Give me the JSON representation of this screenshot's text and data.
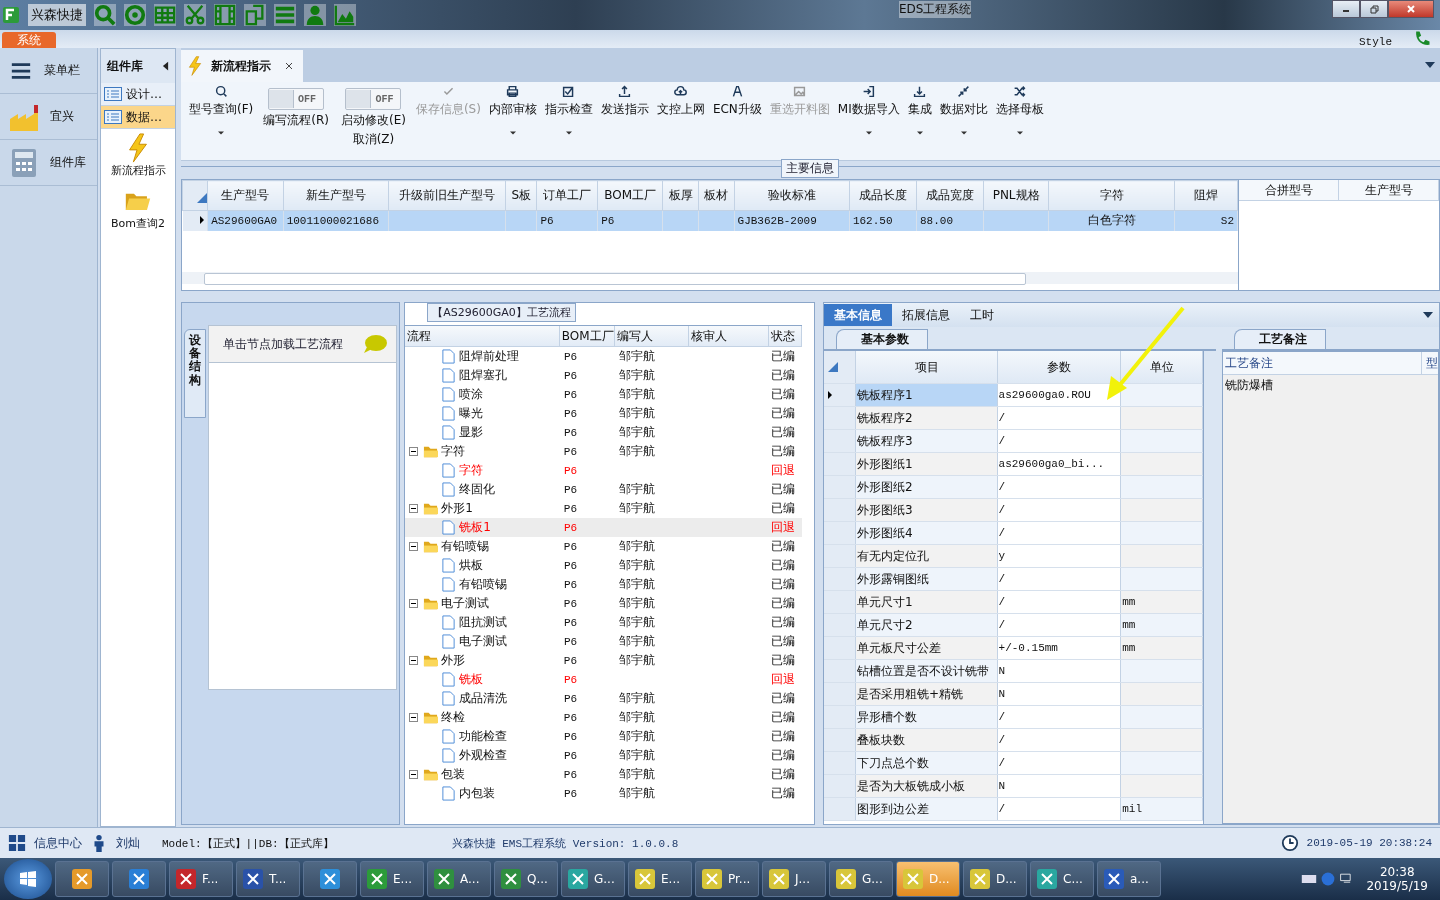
{
  "window": {
    "app_name": "兴森快捷",
    "title": "EDS工程系统"
  },
  "ribbon_tabs": [
    {
      "label": "系统",
      "selected": true
    }
  ],
  "style_menu": {
    "label": "Style"
  },
  "sidebar": {
    "items": [
      {
        "label": "菜单栏",
        "kind": "menu"
      },
      {
        "label": "宜兴",
        "kind": "factory"
      },
      {
        "label": "组件库",
        "kind": "calculator"
      }
    ]
  },
  "component_library": {
    "title": "组件库",
    "items": [
      {
        "label": "设计…",
        "kind": "list",
        "selected": false
      },
      {
        "label": "数据…",
        "kind": "list",
        "selected": true
      },
      {
        "label": "新流程指示",
        "kind": "bolt",
        "selected": false
      },
      {
        "label": "Bom查询2",
        "kind": "folder",
        "selected": false
      }
    ]
  },
  "document_tabs": [
    {
      "label": "新流程指示",
      "selected": true,
      "closable": true
    }
  ],
  "toolbar": [
    {
      "kind": "button",
      "label": "型号查询(F)",
      "disabled": false,
      "dropdown": true
    },
    {
      "kind": "toggle",
      "label": "编写流程(R)",
      "state_text": "OFF",
      "on": false
    },
    {
      "kind": "toggle",
      "label": "启动修改(E)",
      "sublabel": "取消(Z)",
      "state_text": "OFF",
      "on": false
    },
    {
      "kind": "button",
      "label": "保存信息(S)",
      "disabled": true,
      "dropdown": false
    },
    {
      "kind": "button",
      "label": "内部审核",
      "disabled": false,
      "dropdown": true
    },
    {
      "kind": "button",
      "label": "指示检查",
      "disabled": false,
      "dropdown": true
    },
    {
      "kind": "button",
      "label": "发送指示",
      "disabled": false,
      "dropdown": false
    },
    {
      "kind": "button",
      "label": "文控上网",
      "disabled": false,
      "dropdown": false
    },
    {
      "kind": "button",
      "label": "ECN升级",
      "disabled": false,
      "dropdown": false
    },
    {
      "kind": "button",
      "label": "重选开料图",
      "disabled": true,
      "dropdown": false
    },
    {
      "kind": "button",
      "label": "MI数据导入",
      "disabled": false,
      "dropdown": true
    },
    {
      "kind": "button",
      "label": "集成",
      "disabled": false,
      "dropdown": true
    },
    {
      "kind": "button",
      "label": "数据对比",
      "disabled": false,
      "dropdown": true
    },
    {
      "kind": "button",
      "label": "选择母板",
      "disabled": false,
      "dropdown": true
    }
  ],
  "main_info": {
    "title": "主要信息",
    "columns": [
      "生产型号",
      "新生产型号",
      "升级前旧生产型号",
      "S板",
      "订单工厂",
      "BOM工厂",
      "板厚",
      "板材",
      "验收标准",
      "成品长度",
      "成品宽度",
      "PNL规格",
      "字符",
      "阻焊"
    ],
    "rows": [
      {
        "selected": true,
        "cells": [
          "AS29600GA0",
          "10011000021686",
          null,
          null,
          "P6",
          "P6",
          null,
          null,
          "GJB362B-2009",
          "162.50",
          "88.00",
          null,
          "白色字符",
          "S2"
        ]
      }
    ],
    "side_columns": [
      "合拼型号",
      "生产型号"
    ]
  },
  "process": {
    "title": "【AS29600GA0】工艺流程",
    "side_tab": "设备结构",
    "hint": "单击节点加载工艺流程",
    "columns": [
      "流程",
      "BOM工厂",
      "编写人",
      "核审人",
      "状态"
    ],
    "tree": [
      {
        "children": [
          {
            "label": "阻焊前处理",
            "bom": "P6",
            "writer": "邹宇航",
            "status": "已编",
            "returned": false,
            "selected": false
          },
          {
            "label": "阻焊塞孔",
            "bom": "P6",
            "writer": "邹宇航",
            "status": "已编",
            "returned": false,
            "selected": false
          },
          {
            "label": "喷涂",
            "bom": "P6",
            "writer": "邹宇航",
            "status": "已编",
            "returned": false,
            "selected": false
          },
          {
            "label": "曝光",
            "bom": "P6",
            "writer": "邹宇航",
            "status": "已编",
            "returned": false,
            "selected": false
          },
          {
            "label": "显影",
            "bom": "P6",
            "writer": "邹宇航",
            "status": "已编",
            "returned": false,
            "selected": false
          }
        ]
      },
      {
        "label": "字符",
        "bom": "P6",
        "writer": "邹宇航",
        "status": "已编",
        "returned": false,
        "selected": false,
        "expanded": true,
        "children": [
          {
            "label": "字符",
            "bom": "P6",
            "status": "回退",
            "returned": true,
            "selected": false
          },
          {
            "label": "终固化",
            "bom": "P6",
            "writer": "邹宇航",
            "status": "已编",
            "returned": false,
            "selected": false
          }
        ]
      },
      {
        "label": "外形1",
        "bom": "P6",
        "writer": "邹宇航",
        "status": "已编",
        "returned": false,
        "selected": false,
        "expanded": true,
        "children": [
          {
            "label": "铣板1",
            "bom": "P6",
            "status": "回退",
            "returned": true,
            "selected": true
          }
        ]
      },
      {
        "label": "有铅喷锡",
        "bom": "P6",
        "writer": "邹宇航",
        "status": "已编",
        "returned": false,
        "selected": false,
        "expanded": true,
        "children": [
          {
            "label": "烘板",
            "bom": "P6",
            "writer": "邹宇航",
            "status": "已编",
            "returned": false,
            "selected": false
          },
          {
            "label": "有铅喷锡",
            "bom": "P6",
            "writer": "邹宇航",
            "status": "已编",
            "returned": false,
            "selected": false
          }
        ]
      },
      {
        "label": "电子测试",
        "bom": "P6",
        "writer": "邹宇航",
        "status": "已编",
        "returned": false,
        "selected": false,
        "expanded": true,
        "children": [
          {
            "label": "阻抗测试",
            "bom": "P6",
            "writer": "邹宇航",
            "status": "已编",
            "returned": false,
            "selected": false
          },
          {
            "label": "电子测试",
            "bom": "P6",
            "writer": "邹宇航",
            "status": "已编",
            "returned": false,
            "selected": false
          }
        ]
      },
      {
        "label": "外形",
        "bom": "P6",
        "writer": "邹宇航",
        "status": "已编",
        "returned": false,
        "selected": false,
        "expanded": true,
        "children": [
          {
            "label": "铣板",
            "bom": "P6",
            "status": "回退",
            "returned": true,
            "selected": false
          },
          {
            "label": "成品清洗",
            "bom": "P6",
            "writer": "邹宇航",
            "status": "已编",
            "returned": false,
            "selected": false
          }
        ]
      },
      {
        "label": "终检",
        "bom": "P6",
        "writer": "邹宇航",
        "status": "已编",
        "returned": false,
        "selected": false,
        "expanded": true,
        "children": [
          {
            "label": "功能检查",
            "bom": "P6",
            "writer": "邹宇航",
            "status": "已编",
            "returned": false,
            "selected": false
          },
          {
            "label": "外观检查",
            "bom": "P6",
            "writer": "邹宇航",
            "status": "已编",
            "returned": false,
            "selected": false
          }
        ]
      },
      {
        "label": "包装",
        "bom": "P6",
        "writer": "邹宇航",
        "status": "已编",
        "returned": false,
        "selected": false,
        "expanded": true,
        "children": [
          {
            "label": "内包装",
            "bom": "P6",
            "writer": "邹宇航",
            "status": "已编",
            "returned": false,
            "selected": false
          }
        ]
      }
    ]
  },
  "detail": {
    "tabs": [
      {
        "label": "基本信息",
        "selected": true
      },
      {
        "label": "拓展信息",
        "selected": false
      },
      {
        "label": "工时",
        "selected": false
      }
    ],
    "sub_tab": "基本参数",
    "columns": [
      "项目",
      "参数",
      "单位"
    ],
    "rows": [
      {
        "item": "铣板程序1",
        "value": "as29600ga0.ROU",
        "selected": true
      },
      {
        "item": "铣板程序2",
        "value": "/",
        "selected": false
      },
      {
        "item": "铣板程序3",
        "value": "/",
        "selected": false
      },
      {
        "item": "外形图纸1",
        "value": "as29600ga0_bi...",
        "selected": false
      },
      {
        "item": "外形图纸2",
        "value": "/",
        "selected": false
      },
      {
        "item": "外形图纸3",
        "value": "/",
        "selected": false
      },
      {
        "item": "外形图纸4",
        "value": "/",
        "selected": false
      },
      {
        "item": "有无内定位孔",
        "value": "y",
        "selected": false
      },
      {
        "item": "外形露铜图纸",
        "value": "/",
        "selected": false
      },
      {
        "item": "单元尺寸1",
        "value": "/",
        "unit": "mm",
        "selected": false
      },
      {
        "item": "单元尺寸2",
        "value": "/",
        "unit": "mm",
        "selected": false
      },
      {
        "item": "单元板尺寸公差",
        "value": "+/-0.15mm",
        "unit": "mm",
        "selected": false
      },
      {
        "item": "钻槽位置是否不设计铣带",
        "value": "N",
        "selected": false
      },
      {
        "item": "是否采用粗铣+精铣",
        "value": "N",
        "selected": false
      },
      {
        "item": "异形槽个数",
        "value": "/",
        "selected": false
      },
      {
        "item": "叠板块数",
        "value": "/",
        "selected": false
      },
      {
        "item": "下刀点总个数",
        "value": "/",
        "selected": false
      },
      {
        "item": "是否为大板铣成小板",
        "value": "N",
        "selected": false
      },
      {
        "item": "图形到边公差",
        "value": "/",
        "unit": "mil",
        "selected": false
      }
    ]
  },
  "notes": {
    "tab": "工艺备注",
    "columns": [
      "工艺备注",
      "型"
    ],
    "rows": [
      "铣防爆槽"
    ]
  },
  "status_bar": {
    "info_center": "信息中心",
    "user": "刘灿",
    "model": "Model:【正式】||DB:【正式库】",
    "product": "兴森快捷 EMS工程系统 Version: 1.0.0.8",
    "datetime": "2019-05-19 20:38:24"
  },
  "taskbar": {
    "items": [
      {
        "selected": false
      },
      {
        "selected": false
      },
      {
        "label": "F...",
        "selected": false
      },
      {
        "label": "T...",
        "selected": false
      },
      {
        "selected": false
      },
      {
        "label": "E...",
        "selected": false
      },
      {
        "label": "A...",
        "selected": false
      },
      {
        "label": "Q...",
        "selected": false
      },
      {
        "label": "G...",
        "selected": false
      },
      {
        "label": "E...",
        "selected": false
      },
      {
        "label": "Pr...",
        "selected": false
      },
      {
        "label": "J...",
        "selected": false
      },
      {
        "label": "G...",
        "selected": false
      },
      {
        "label": "D...",
        "selected": true
      },
      {
        "label": "D...",
        "selected": false
      },
      {
        "label": "C...",
        "selected": false
      },
      {
        "label": "a...",
        "selected": false
      }
    ],
    "time": "20:38",
    "date": "2019/5/19"
  }
}
